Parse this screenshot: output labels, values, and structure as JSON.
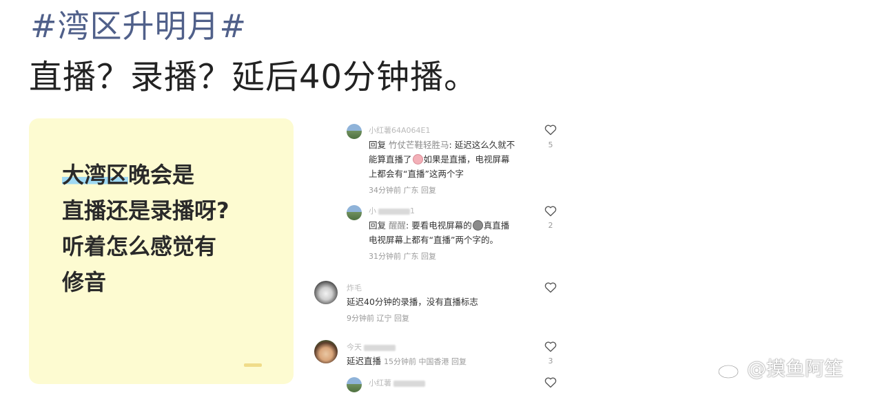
{
  "post": {
    "hashtag": "#湾区升明月#",
    "headline": "直播？录播？延后40分钟播。"
  },
  "card": {
    "line1_highlight": "大湾区",
    "line1_rest": "晚会是",
    "line2": "直播还是录播呀?",
    "line3": "听着怎么感觉有",
    "line4": "修音"
  },
  "comments": [
    {
      "user": "小红薯64A064E1",
      "reply_label": "回复",
      "reply_to": "竹仗芒鞋轻胜马",
      "text_a": ": 延迟这么久就不",
      "text_b": "能算直播了",
      "text_c": "如果是直播，电视屏幕",
      "text_d": "上都会有“直播”这两个字",
      "meta": "34分钟前 广东 回复",
      "likes": "5"
    },
    {
      "user": "小",
      "user_tail": "1",
      "reply_label": "回复",
      "reply_to": "醒醒",
      "text_a": ": 要看电视屏幕的",
      "text_b": "真直播",
      "text_c": "电视屏幕上都有“直播”两个字的。",
      "meta": "31分钟前 广东 回复",
      "likes": "2"
    },
    {
      "user": "炸毛",
      "text": "延迟40分钟的录播，没有直播标志",
      "meta": "9分钟前 辽宁 回复",
      "likes": ""
    },
    {
      "user": "今天",
      "text": "延迟直播",
      "meta": "15分钟前 中国香港 回复",
      "likes": "3"
    },
    {
      "user": "小红薯",
      "likes": ""
    }
  ],
  "watermark": {
    "text": "@摸鱼阿笙",
    "icon": "weibo-logo-icon"
  },
  "colors": {
    "hashtag": "#50608a",
    "card_bg": "#fdfbd1",
    "highlight": "#9fd9f3"
  }
}
